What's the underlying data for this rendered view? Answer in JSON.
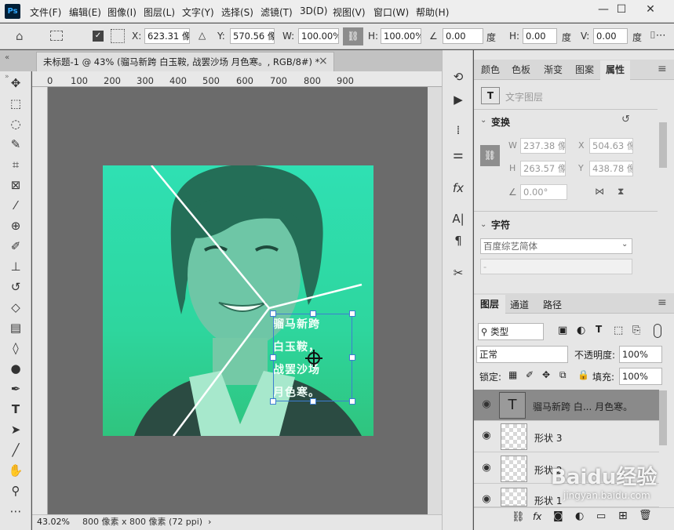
{
  "app": {
    "logo": "Ps",
    "accent": "#31a8ff"
  },
  "menu": [
    "文件(F)",
    "编辑(E)",
    "图像(I)",
    "图层(L)",
    "文字(Y)",
    "选择(S)",
    "滤镜(T)",
    "3D(D)",
    "视图(V)",
    "窗口(W)",
    "帮助(H)"
  ],
  "window_controls": {
    "minimize": "—",
    "maximize": "☐",
    "close": "✕"
  },
  "options": {
    "x_label": "X:",
    "x_value": "623.31 像素",
    "y_label": "Y:",
    "y_value": "570.56 像素",
    "w_label": "W:",
    "w_value": "100.00%",
    "h_label": "H:",
    "h_value": "100.00%",
    "angle_value": "0.00",
    "angle_unit": "度",
    "h2_label": "H:",
    "h2_value": "0.00",
    "h2_unit": "度",
    "v_label": "V:",
    "v_value": "0.00",
    "v_unit": "度"
  },
  "document_tab": {
    "title": "未标题-1 @ 43% (骝马新跨 白玉鞍, 战罢沙场 月色寒。, RGB/8#) *",
    "close": "×"
  },
  "ruler": [
    "0",
    "100",
    "200",
    "300",
    "400",
    "500",
    "600",
    "700",
    "800",
    "900"
  ],
  "canvas": {
    "poem_lines": [
      "骝马新跨",
      "白玉鞍，",
      "战罢沙场",
      "月色寒。"
    ],
    "color_top": "#2fe0b3",
    "color_bottom": "#2fc47e"
  },
  "status": {
    "zoom": "43.02%",
    "info": "800 像素 x 800 像素 (72 ppi)",
    "arrow": "›"
  },
  "panels": {
    "tabs": [
      "颜色",
      "色板",
      "渐变",
      "图案",
      "属性"
    ],
    "active_tab": "属性",
    "layer_type": "文字图层",
    "transform": {
      "title": "变换",
      "w_label": "W",
      "w_value": "237.38 像素",
      "x_label": "X",
      "x_value": "504.63 像素",
      "h_label": "H",
      "h_value": "263.57 像素",
      "y_label": "Y",
      "y_value": "438.78 像素",
      "angle_value": "0.00°"
    },
    "character": {
      "title": "字符",
      "font_family": "百度综艺简体",
      "font_style": "-"
    }
  },
  "layers_panel": {
    "tabs": [
      "图层",
      "通道",
      "路径"
    ],
    "active_tab": "图层",
    "filter_label": "类型",
    "blend_mode": "正常",
    "opacity_label": "不透明度:",
    "opacity_value": "100%",
    "lock_label": "锁定:",
    "fill_label": "填充:",
    "fill_value": "100%",
    "layers": [
      {
        "name": "骝马新跨 白... 月色寒。",
        "thumb": "T"
      },
      {
        "name": "形状 3"
      },
      {
        "name": "形状 2"
      },
      {
        "name": "形状 1"
      }
    ],
    "bottom_icons": [
      "link-icon",
      "fx-icon",
      "mask-icon",
      "adjustment-icon",
      "folder-icon",
      "new-layer-icon",
      "trash-icon"
    ]
  },
  "watermark": {
    "text": "Baidu经验",
    "url": "jingyan.baidu.com"
  }
}
